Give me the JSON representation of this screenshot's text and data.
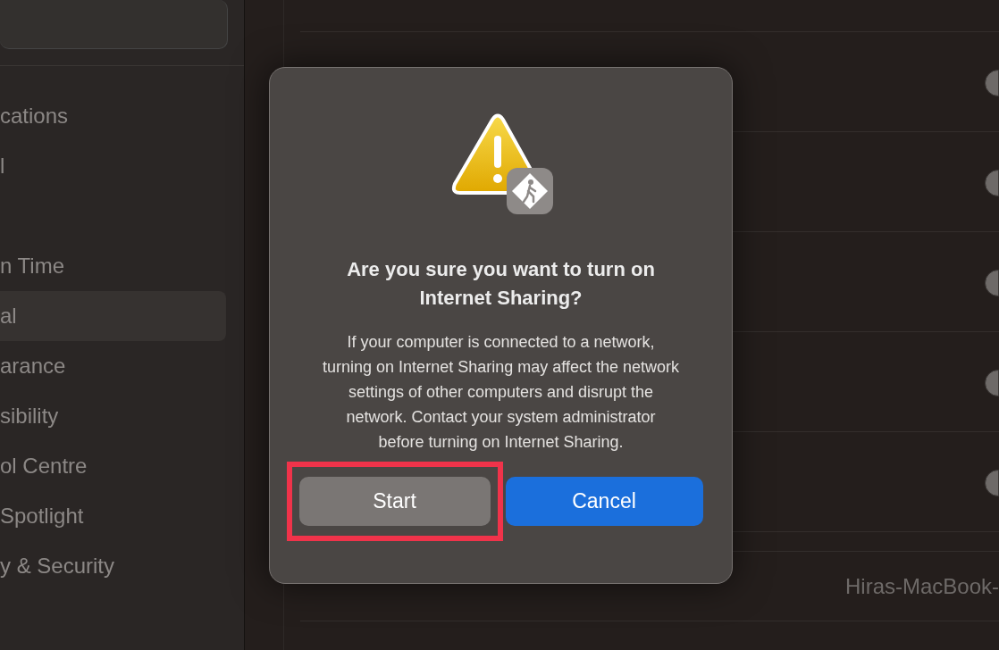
{
  "sidebar": {
    "items": [
      {
        "label": "cations",
        "selected": false
      },
      {
        "label": "l",
        "selected": false
      },
      {
        "label": "n Time",
        "selected": false
      },
      {
        "label": "al",
        "selected": true
      },
      {
        "label": "arance",
        "selected": false
      },
      {
        "label": "sibility",
        "selected": false
      },
      {
        "label": "ol Centre",
        "selected": false
      },
      {
        "label": "Spotlight",
        "selected": false
      },
      {
        "label": "y & Security",
        "selected": false
      }
    ]
  },
  "content": {
    "rows": [
      {
        "on": false
      },
      {
        "on": false
      },
      {
        "on": false
      },
      {
        "on": false
      },
      {
        "on": false
      }
    ],
    "hostname_value": "Hiras-MacBook-"
  },
  "dialog": {
    "title": "Are you sure you want to turn on Internet Sharing?",
    "message": "If your computer is connected to a network, turning on Internet Sharing may affect the network settings of other computers and disrupt the network. Contact your system administrator before turning on Internet Sharing.",
    "buttons": [
      {
        "label": "Start",
        "kind": "default",
        "highlighted": true
      },
      {
        "label": "Cancel",
        "kind": "primary",
        "highlighted": false
      }
    ]
  }
}
